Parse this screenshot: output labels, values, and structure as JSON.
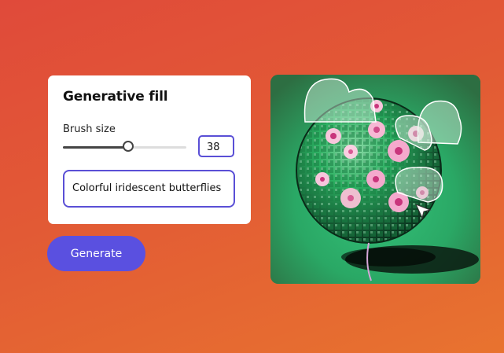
{
  "panel": {
    "title": "Generative fill",
    "brush_label": "Brush size",
    "brush_value": "38",
    "brush_fraction": 0.53,
    "prompt_value": "Colorful iridescent butterflies"
  },
  "generate_label": "Generate",
  "colors": {
    "accent": "#5a50e0",
    "background_start": "#e04a3a",
    "background_end": "#e8732f",
    "canvas_green": "#2fa860"
  }
}
